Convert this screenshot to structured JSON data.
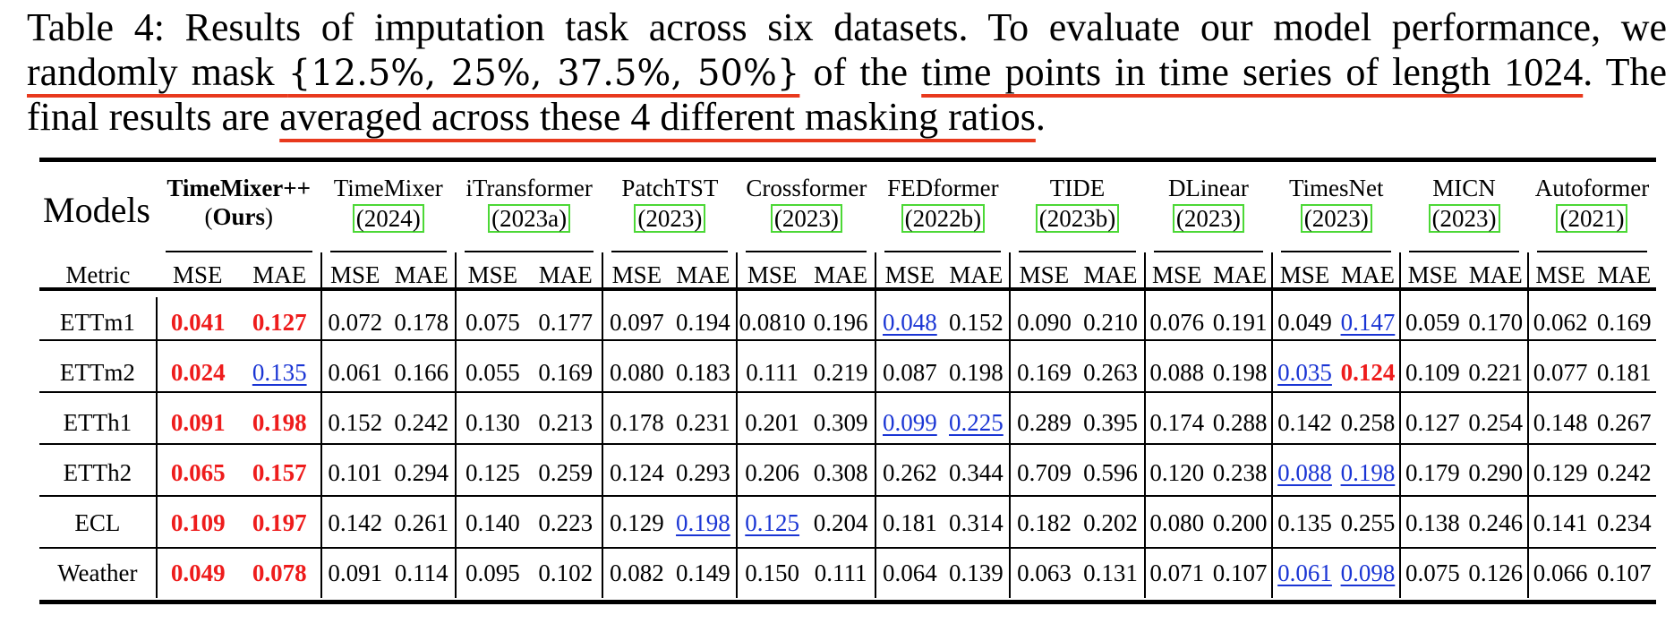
{
  "caption": {
    "line1": "Table 4: Results of imputation task across six datasets. To evaluate our model performance, we",
    "line2_pre": "randomly mask ",
    "line2_math": "{12.5%, 25%, 37.5%, 50%}",
    "line2_mid": " of the ",
    "line2_ul": "time points in time series of length 1024",
    "line2_post": ". The",
    "line3_pre": "final results are ",
    "line3_ul": "averaged across these 4 different masking ratios",
    "line3_post": "."
  },
  "table": {
    "models_label": "Models",
    "metric_label": "Metric",
    "mse": "MSE",
    "mae": "MAE",
    "ours": {
      "name": "TimeMixer++",
      "tag_open": "(",
      "tag_bold": "Ours",
      "tag_close": ")"
    },
    "models": [
      {
        "name": "TimeMixer",
        "year": "(2024)"
      },
      {
        "name": "iTransformer",
        "year": "(2023a)"
      },
      {
        "name": "PatchTST",
        "year": "(2023)"
      },
      {
        "name": "Crossformer",
        "year": "(2023)"
      },
      {
        "name": "FEDformer",
        "year": "(2022b)"
      },
      {
        "name": "TIDE",
        "year": "(2023b)"
      },
      {
        "name": "DLinear",
        "year": "(2023)"
      },
      {
        "name": "TimesNet",
        "year": "(2023)"
      },
      {
        "name": "MICN",
        "year": "(2023)"
      },
      {
        "name": "Autoformer",
        "year": "(2021)"
      }
    ],
    "rows": [
      {
        "dataset": "ETTm1",
        "cells": [
          {
            "v": "0.041",
            "s": "best"
          },
          {
            "v": "0.127",
            "s": "best"
          },
          {
            "v": "0.072"
          },
          {
            "v": "0.178"
          },
          {
            "v": "0.075"
          },
          {
            "v": "0.177"
          },
          {
            "v": "0.097"
          },
          {
            "v": "0.194"
          },
          {
            "v": "0.0810"
          },
          {
            "v": "0.196"
          },
          {
            "v": "0.048",
            "s": "second"
          },
          {
            "v": "0.152"
          },
          {
            "v": "0.090"
          },
          {
            "v": "0.210"
          },
          {
            "v": "0.076"
          },
          {
            "v": "0.191"
          },
          {
            "v": "0.049"
          },
          {
            "v": "0.147",
            "s": "second"
          },
          {
            "v": "0.059"
          },
          {
            "v": "0.170"
          },
          {
            "v": "0.062"
          },
          {
            "v": "0.169"
          }
        ]
      },
      {
        "dataset": "ETTm2",
        "cells": [
          {
            "v": "0.024",
            "s": "best"
          },
          {
            "v": "0.135",
            "s": "second"
          },
          {
            "v": "0.061"
          },
          {
            "v": "0.166"
          },
          {
            "v": "0.055"
          },
          {
            "v": "0.169"
          },
          {
            "v": "0.080"
          },
          {
            "v": "0.183"
          },
          {
            "v": "0.111"
          },
          {
            "v": "0.219"
          },
          {
            "v": "0.087"
          },
          {
            "v": "0.198"
          },
          {
            "v": "0.169"
          },
          {
            "v": "0.263"
          },
          {
            "v": "0.088"
          },
          {
            "v": "0.198"
          },
          {
            "v": "0.035",
            "s": "second"
          },
          {
            "v": "0.124",
            "s": "best"
          },
          {
            "v": "0.109"
          },
          {
            "v": "0.221"
          },
          {
            "v": "0.077"
          },
          {
            "v": "0.181"
          }
        ]
      },
      {
        "dataset": "ETTh1",
        "cells": [
          {
            "v": "0.091",
            "s": "best"
          },
          {
            "v": "0.198",
            "s": "best"
          },
          {
            "v": "0.152"
          },
          {
            "v": "0.242"
          },
          {
            "v": "0.130"
          },
          {
            "v": "0.213"
          },
          {
            "v": "0.178"
          },
          {
            "v": "0.231"
          },
          {
            "v": "0.201"
          },
          {
            "v": "0.309"
          },
          {
            "v": "0.099",
            "s": "second"
          },
          {
            "v": "0.225",
            "s": "second"
          },
          {
            "v": "0.289"
          },
          {
            "v": "0.395"
          },
          {
            "v": "0.174"
          },
          {
            "v": "0.288"
          },
          {
            "v": "0.142"
          },
          {
            "v": "0.258"
          },
          {
            "v": "0.127"
          },
          {
            "v": "0.254"
          },
          {
            "v": "0.148"
          },
          {
            "v": "0.267"
          }
        ]
      },
      {
        "dataset": "ETTh2",
        "cells": [
          {
            "v": "0.065",
            "s": "best"
          },
          {
            "v": "0.157",
            "s": "best"
          },
          {
            "v": "0.101"
          },
          {
            "v": "0.294"
          },
          {
            "v": "0.125"
          },
          {
            "v": "0.259"
          },
          {
            "v": "0.124"
          },
          {
            "v": "0.293"
          },
          {
            "v": "0.206"
          },
          {
            "v": "0.308"
          },
          {
            "v": "0.262"
          },
          {
            "v": "0.344"
          },
          {
            "v": "0.709"
          },
          {
            "v": "0.596"
          },
          {
            "v": "0.120"
          },
          {
            "v": "0.238"
          },
          {
            "v": "0.088",
            "s": "second"
          },
          {
            "v": "0.198",
            "s": "second"
          },
          {
            "v": "0.179"
          },
          {
            "v": "0.290"
          },
          {
            "v": "0.129"
          },
          {
            "v": "0.242"
          }
        ]
      },
      {
        "dataset": "ECL",
        "cells": [
          {
            "v": "0.109",
            "s": "best"
          },
          {
            "v": "0.197",
            "s": "best"
          },
          {
            "v": "0.142"
          },
          {
            "v": "0.261"
          },
          {
            "v": "0.140"
          },
          {
            "v": "0.223"
          },
          {
            "v": "0.129"
          },
          {
            "v": "0.198",
            "s": "second"
          },
          {
            "v": "0.125",
            "s": "second"
          },
          {
            "v": "0.204"
          },
          {
            "v": "0.181"
          },
          {
            "v": "0.314"
          },
          {
            "v": "0.182"
          },
          {
            "v": "0.202"
          },
          {
            "v": "0.080"
          },
          {
            "v": "0.200"
          },
          {
            "v": "0.135"
          },
          {
            "v": "0.255"
          },
          {
            "v": "0.138"
          },
          {
            "v": "0.246"
          },
          {
            "v": "0.141"
          },
          {
            "v": "0.234"
          }
        ]
      },
      {
        "dataset": "Weather",
        "cells": [
          {
            "v": "0.049",
            "s": "best"
          },
          {
            "v": "0.078",
            "s": "best"
          },
          {
            "v": "0.091"
          },
          {
            "v": "0.114"
          },
          {
            "v": "0.095"
          },
          {
            "v": "0.102"
          },
          {
            "v": "0.082"
          },
          {
            "v": "0.149"
          },
          {
            "v": "0.150"
          },
          {
            "v": "0.111"
          },
          {
            "v": "0.064"
          },
          {
            "v": "0.139"
          },
          {
            "v": "0.063"
          },
          {
            "v": "0.131"
          },
          {
            "v": "0.071"
          },
          {
            "v": "0.107"
          },
          {
            "v": "0.061",
            "s": "second"
          },
          {
            "v": "0.098",
            "s": "second"
          },
          {
            "v": "0.075"
          },
          {
            "v": "0.126"
          },
          {
            "v": "0.066"
          },
          {
            "v": "0.107"
          }
        ]
      }
    ]
  },
  "colors": {
    "best": "#ee1c1c",
    "second": "#1a35d4",
    "citation_box": "#4cd836",
    "annotation_underline": "#e8391d"
  }
}
